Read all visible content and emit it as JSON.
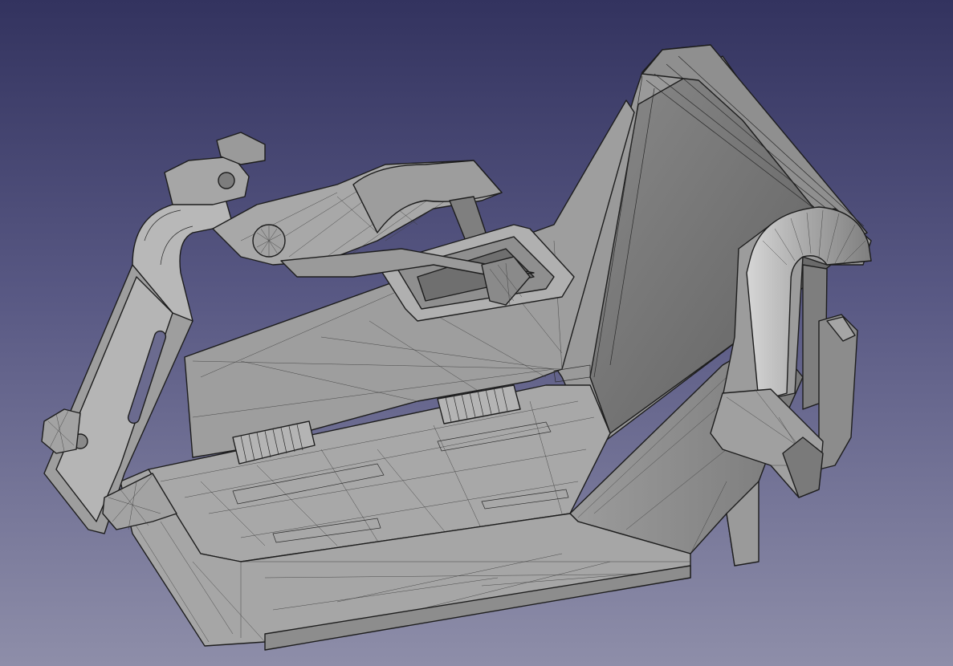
{
  "viewport": {
    "background_top": "#33335f",
    "background_bottom": "#8e8ea9"
  },
  "model": {
    "face_color": "#a3a3a3",
    "face_shade": "#8c8c8c",
    "face_dark": "#6e6e6e",
    "face_light": "#bdbdbd",
    "edge_color": "#1d1d1d"
  }
}
